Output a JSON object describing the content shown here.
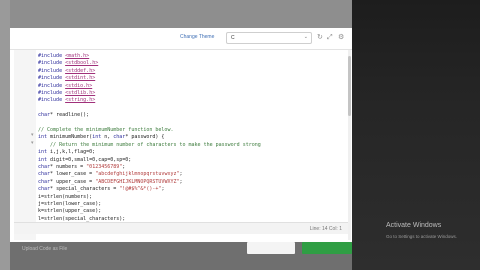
{
  "toolbar": {
    "change_theme_label": "Change Theme",
    "language_value": "C",
    "icons": [
      "history-icon",
      "fullscreen-icon",
      "settings-icon"
    ]
  },
  "editor": {
    "lines": [
      "#include <math.h>",
      "#include <stdbool.h>",
      "#include <stddef.h>",
      "#include <stdint.h>",
      "#include <stdio.h>",
      "#include <stdlib.h>",
      "#include <string.h>",
      "",
      "char* readline();",
      "",
      "// Complete the minimumNumber function below.",
      "int minimumNumber(int n, char* password) {",
      "    // Return the minimum number of characters to make the password strong",
      "int i,j,k,l,flag=0;",
      "int digit=0,small=0,cap=0,sp=0;",
      "char* numbers = \"0123456789\";",
      "char* lower_case = \"abcdefghijklmnopqrstuvwxyz\";",
      "char* upper_case = \"ABCDEFGHIJKLMNOPQRSTUVWXYZ\";",
      "char* special_characters = \"!@#$%^&*()-+\";",
      "i=strlen(numbers);",
      "j=strlen(lower_case);",
      "k=strlen(upper_case);",
      "l=strlen(special_characters);"
    ]
  },
  "status": {
    "text": "Line: 14 Col: 1"
  },
  "overlay": {
    "activate_title": "Activate Windows",
    "activate_sub": "Go to Settings to activate Windows."
  },
  "bottom": {
    "note": "Upload Code as File"
  }
}
